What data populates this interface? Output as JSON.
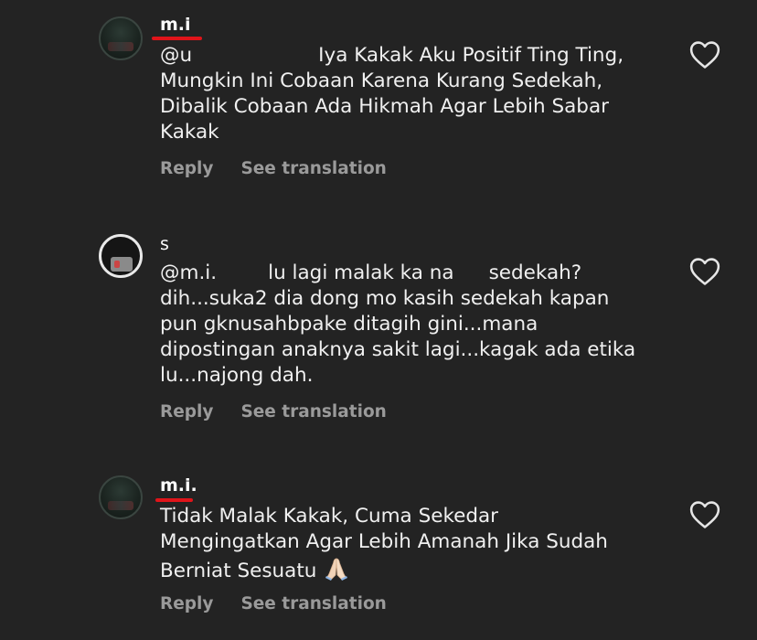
{
  "comments": [
    {
      "username": "m.i",
      "mention": "@u",
      "lines": [
        "Iya Kakak Aku Positif Ting Ting,",
        "Mungkin Ini Cobaan Karena Kurang Sedekah,",
        "Dibalik Cobaan Ada Hikmah Agar Lebih Sabar",
        "Kakak"
      ],
      "reply_label": "Reply",
      "translate_label": "See translation",
      "like_icon": "heart-outline-icon"
    },
    {
      "username": "s",
      "mention": "@m.i.",
      "line1_part1": "lu lagi malak ka na",
      "line1_part2": "sedekah?",
      "lines": [
        "dih...suka2 dia dong mo kasih sedekah kapan",
        "pun gknusahbpake ditagih gini...mana",
        "dipostingan anaknya sakit lagi...kagak ada etika",
        "lu...najong dah."
      ],
      "reply_label": "Reply",
      "translate_label": "See translation",
      "like_icon": "heart-outline-icon"
    },
    {
      "username": "m.i.",
      "lines": [
        "Tidak Malak Kakak, Cuma Sekedar",
        "Mengingatkan Agar Lebih Amanah Jika Sudah",
        "Berniat Sesuatu"
      ],
      "emoji": "folded-hands-emoji",
      "reply_label": "Reply",
      "translate_label": "See translation",
      "like_icon": "heart-outline-icon"
    }
  ],
  "colors": {
    "background": "#232323",
    "text": "#f0f0f0",
    "muted": "#9a9a9a",
    "annotation_underline": "#e0141a"
  }
}
